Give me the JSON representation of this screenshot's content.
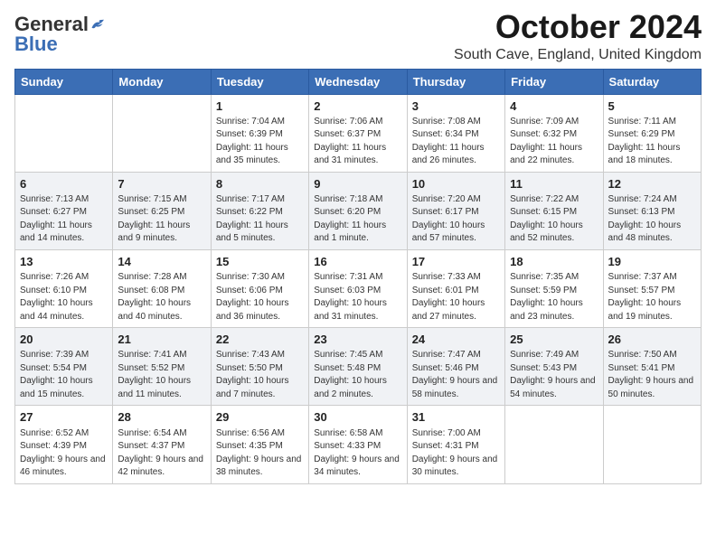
{
  "logo": {
    "general": "General",
    "blue": "Blue"
  },
  "title": "October 2024",
  "location": "South Cave, England, United Kingdom",
  "days_of_week": [
    "Sunday",
    "Monday",
    "Tuesday",
    "Wednesday",
    "Thursday",
    "Friday",
    "Saturday"
  ],
  "weeks": [
    [
      {
        "day": "",
        "info": ""
      },
      {
        "day": "",
        "info": ""
      },
      {
        "day": "1",
        "info": "Sunrise: 7:04 AM\nSunset: 6:39 PM\nDaylight: 11 hours and 35 minutes."
      },
      {
        "day": "2",
        "info": "Sunrise: 7:06 AM\nSunset: 6:37 PM\nDaylight: 11 hours and 31 minutes."
      },
      {
        "day": "3",
        "info": "Sunrise: 7:08 AM\nSunset: 6:34 PM\nDaylight: 11 hours and 26 minutes."
      },
      {
        "day": "4",
        "info": "Sunrise: 7:09 AM\nSunset: 6:32 PM\nDaylight: 11 hours and 22 minutes."
      },
      {
        "day": "5",
        "info": "Sunrise: 7:11 AM\nSunset: 6:29 PM\nDaylight: 11 hours and 18 minutes."
      }
    ],
    [
      {
        "day": "6",
        "info": "Sunrise: 7:13 AM\nSunset: 6:27 PM\nDaylight: 11 hours and 14 minutes."
      },
      {
        "day": "7",
        "info": "Sunrise: 7:15 AM\nSunset: 6:25 PM\nDaylight: 11 hours and 9 minutes."
      },
      {
        "day": "8",
        "info": "Sunrise: 7:17 AM\nSunset: 6:22 PM\nDaylight: 11 hours and 5 minutes."
      },
      {
        "day": "9",
        "info": "Sunrise: 7:18 AM\nSunset: 6:20 PM\nDaylight: 11 hours and 1 minute."
      },
      {
        "day": "10",
        "info": "Sunrise: 7:20 AM\nSunset: 6:17 PM\nDaylight: 10 hours and 57 minutes."
      },
      {
        "day": "11",
        "info": "Sunrise: 7:22 AM\nSunset: 6:15 PM\nDaylight: 10 hours and 52 minutes."
      },
      {
        "day": "12",
        "info": "Sunrise: 7:24 AM\nSunset: 6:13 PM\nDaylight: 10 hours and 48 minutes."
      }
    ],
    [
      {
        "day": "13",
        "info": "Sunrise: 7:26 AM\nSunset: 6:10 PM\nDaylight: 10 hours and 44 minutes."
      },
      {
        "day": "14",
        "info": "Sunrise: 7:28 AM\nSunset: 6:08 PM\nDaylight: 10 hours and 40 minutes."
      },
      {
        "day": "15",
        "info": "Sunrise: 7:30 AM\nSunset: 6:06 PM\nDaylight: 10 hours and 36 minutes."
      },
      {
        "day": "16",
        "info": "Sunrise: 7:31 AM\nSunset: 6:03 PM\nDaylight: 10 hours and 31 minutes."
      },
      {
        "day": "17",
        "info": "Sunrise: 7:33 AM\nSunset: 6:01 PM\nDaylight: 10 hours and 27 minutes."
      },
      {
        "day": "18",
        "info": "Sunrise: 7:35 AM\nSunset: 5:59 PM\nDaylight: 10 hours and 23 minutes."
      },
      {
        "day": "19",
        "info": "Sunrise: 7:37 AM\nSunset: 5:57 PM\nDaylight: 10 hours and 19 minutes."
      }
    ],
    [
      {
        "day": "20",
        "info": "Sunrise: 7:39 AM\nSunset: 5:54 PM\nDaylight: 10 hours and 15 minutes."
      },
      {
        "day": "21",
        "info": "Sunrise: 7:41 AM\nSunset: 5:52 PM\nDaylight: 10 hours and 11 minutes."
      },
      {
        "day": "22",
        "info": "Sunrise: 7:43 AM\nSunset: 5:50 PM\nDaylight: 10 hours and 7 minutes."
      },
      {
        "day": "23",
        "info": "Sunrise: 7:45 AM\nSunset: 5:48 PM\nDaylight: 10 hours and 2 minutes."
      },
      {
        "day": "24",
        "info": "Sunrise: 7:47 AM\nSunset: 5:46 PM\nDaylight: 9 hours and 58 minutes."
      },
      {
        "day": "25",
        "info": "Sunrise: 7:49 AM\nSunset: 5:43 PM\nDaylight: 9 hours and 54 minutes."
      },
      {
        "day": "26",
        "info": "Sunrise: 7:50 AM\nSunset: 5:41 PM\nDaylight: 9 hours and 50 minutes."
      }
    ],
    [
      {
        "day": "27",
        "info": "Sunrise: 6:52 AM\nSunset: 4:39 PM\nDaylight: 9 hours and 46 minutes."
      },
      {
        "day": "28",
        "info": "Sunrise: 6:54 AM\nSunset: 4:37 PM\nDaylight: 9 hours and 42 minutes."
      },
      {
        "day": "29",
        "info": "Sunrise: 6:56 AM\nSunset: 4:35 PM\nDaylight: 9 hours and 38 minutes."
      },
      {
        "day": "30",
        "info": "Sunrise: 6:58 AM\nSunset: 4:33 PM\nDaylight: 9 hours and 34 minutes."
      },
      {
        "day": "31",
        "info": "Sunrise: 7:00 AM\nSunset: 4:31 PM\nDaylight: 9 hours and 30 minutes."
      },
      {
        "day": "",
        "info": ""
      },
      {
        "day": "",
        "info": ""
      }
    ]
  ]
}
